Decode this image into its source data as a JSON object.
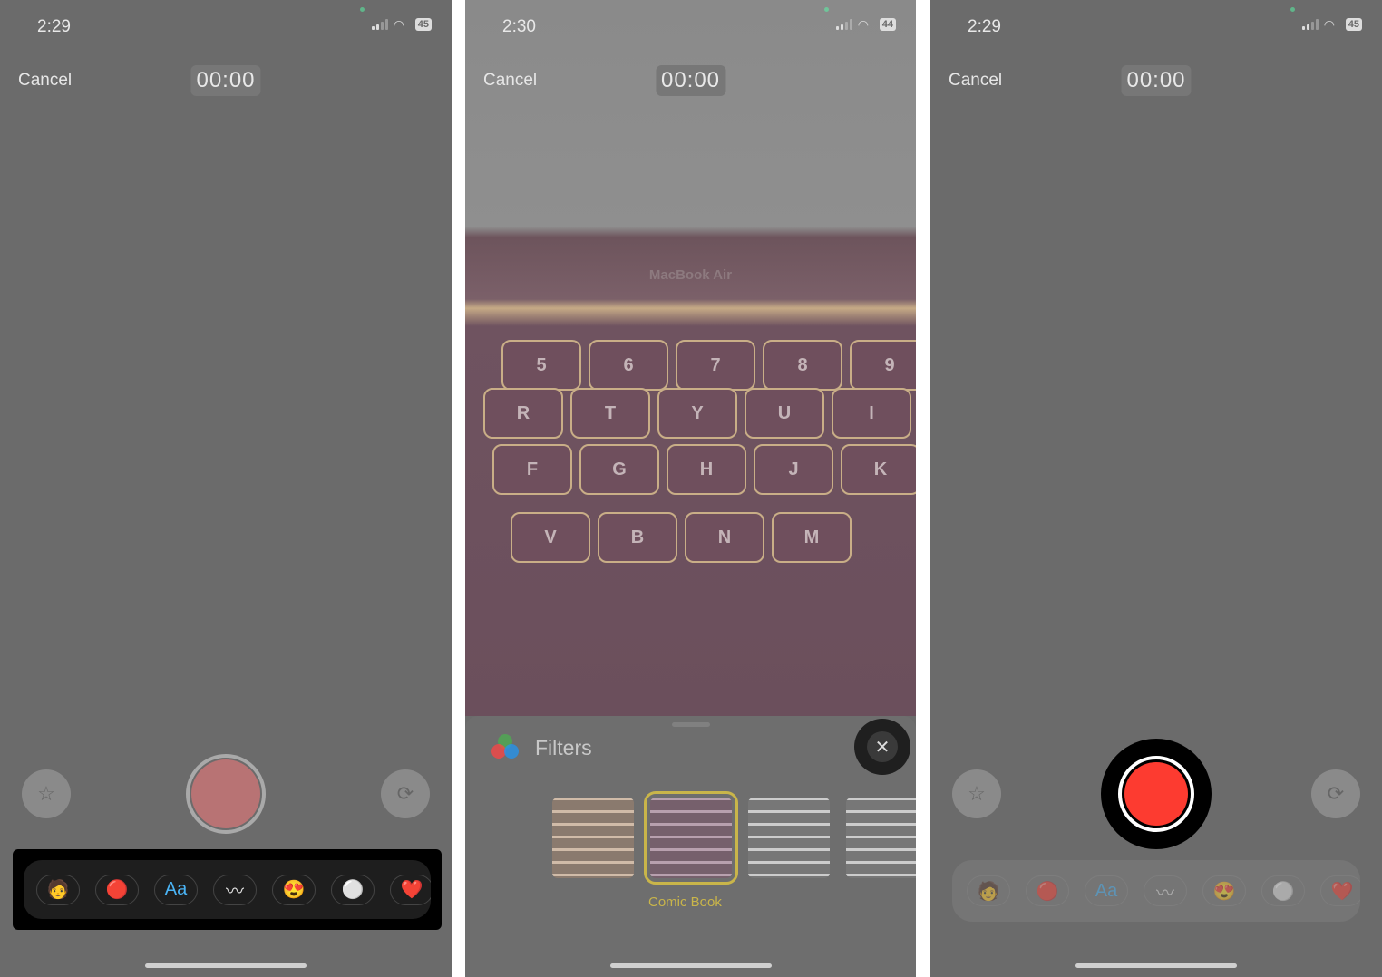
{
  "panels": [
    {
      "time": "2:29",
      "battery": "45",
      "cancel": "Cancel",
      "timer": "00:00"
    },
    {
      "time": "2:30",
      "battery": "44",
      "cancel": "Cancel",
      "timer": "00:00",
      "brand": "MacBook Air",
      "key_rows": [
        [
          "5",
          "6",
          "7",
          "8",
          "9"
        ],
        [
          "R",
          "T",
          "Y",
          "U",
          "I"
        ],
        [
          "F",
          "G",
          "H",
          "J",
          "K"
        ],
        [
          "V",
          "B",
          "N",
          "M"
        ]
      ],
      "filters": {
        "title": "Filters",
        "selected_label": "Comic Book",
        "close_icon": "close-icon"
      }
    },
    {
      "time": "2:29",
      "battery": "45",
      "cancel": "Cancel",
      "timer": "00:00"
    }
  ],
  "apps": [
    {
      "name": "memoji",
      "glyph": "🧑"
    },
    {
      "name": "filters",
      "glyph": "🔴"
    },
    {
      "name": "text",
      "glyph": "Aa"
    },
    {
      "name": "shapes",
      "glyph": "〰"
    },
    {
      "name": "memoji-stickers",
      "glyph": "😍"
    },
    {
      "name": "stickers",
      "glyph": "⚪"
    },
    {
      "name": "emoji-stickers",
      "glyph": "❤️"
    }
  ],
  "colors": {
    "record": "#fd3b30",
    "selected_filter": "#c9b54a",
    "text_blue": "#4ab3f4"
  }
}
